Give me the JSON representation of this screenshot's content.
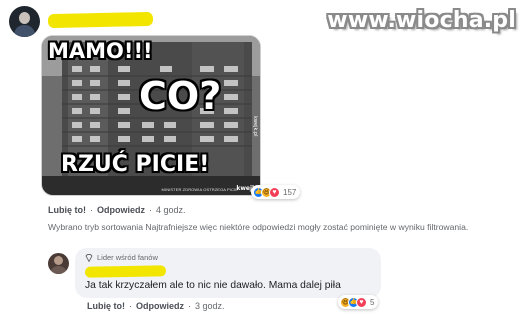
{
  "watermark": "www.wiocha.pl",
  "post": {
    "meme": {
      "line_top": "MAMO!!!",
      "line_mid": "CO?",
      "line_bottom": "RZUĆ PICIE!",
      "footer": "MINISTER ZDROWIA OSTRZEGA PICIE",
      "logo": "kwejk",
      "side_logo": "kwejk.pl"
    },
    "reactions": {
      "icons": [
        "like-icon",
        "haha-icon",
        "love-icon"
      ],
      "count": "157"
    },
    "actions": {
      "like": "Lubię to!",
      "reply": "Odpowiedz",
      "time": "4 godz."
    },
    "filter_note": "Wybrano tryb sortowania Najtrafniejsze więc niektóre odpowiedzi mogły zostać pominięte w wyniku filtrowania."
  },
  "reply": {
    "badge": "Lider wśród fanów",
    "text": "Ja tak krzyczałem ale to nic nie dawało. Mama dalej piła",
    "reactions": {
      "icons": [
        "haha-icon",
        "like-icon",
        "love-icon"
      ],
      "count": "5"
    },
    "actions": {
      "like": "Lubię to!",
      "reply": "Odpowiedz",
      "time": "3 godz."
    }
  },
  "colors": {
    "scribble": "#f2e600",
    "link_blue": "#1877f2",
    "text_gray": "#65676b",
    "bubble_bg": "#f0f2f5"
  }
}
